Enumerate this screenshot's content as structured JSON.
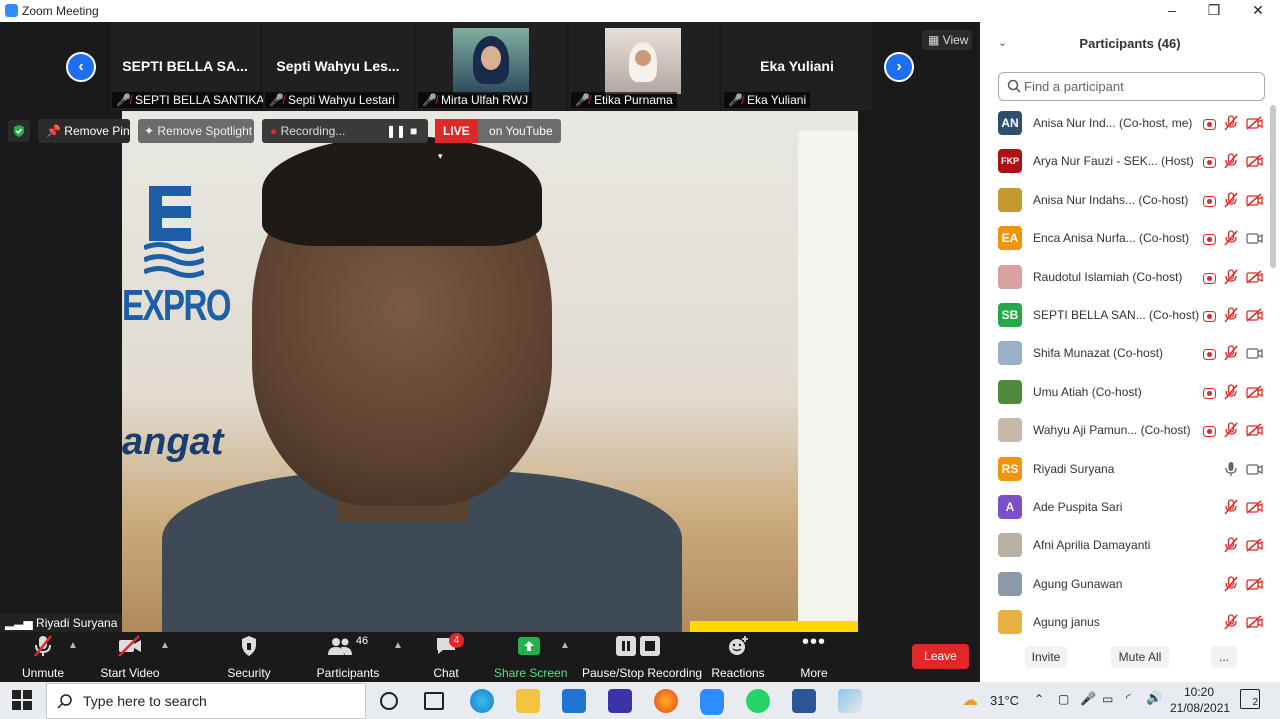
{
  "window": {
    "title": "Zoom Meeting",
    "controls": [
      "–",
      "❐",
      "✕"
    ]
  },
  "strip": {
    "tiles": [
      {
        "name": "SEPTI BELLA SA...",
        "label": "SEPTI BELLA SANTIKA"
      },
      {
        "name": "Septi Wahyu Les...",
        "label": "Septi Wahyu Lestari"
      },
      {
        "name": "",
        "label": "Mirta Ulfah RWJ"
      },
      {
        "name": "",
        "label": "Etika Purnama"
      },
      {
        "name": "Eka Yuliani",
        "label": "Eka Yuliani"
      }
    ],
    "view_label": "View"
  },
  "video": {
    "remove_pin": "Remove Pin",
    "remove_spotlight": "Remove Spotlight",
    "recording": "Recording...",
    "live": "LIVE",
    "live_dest": "on YouTube",
    "speaker": "Riyadi Suryana",
    "bg_text": {
      "expro": "EXPRO",
      "semangat": "angat"
    }
  },
  "toolbar": {
    "unmute": "Unmute",
    "start_video": "Start Video",
    "security": "Security",
    "participants": "Participants",
    "participants_count": "46",
    "chat": "Chat",
    "chat_badge": "4",
    "share_screen": "Share Screen",
    "recording": "Pause/Stop Recording",
    "reactions": "Reactions",
    "more": "More",
    "leave": "Leave"
  },
  "panel": {
    "title": "Participants (46)",
    "search_placeholder": "Find a participant",
    "participants": [
      {
        "initials": "AN",
        "color": "#2f4f6f",
        "name": "Anisa Nur Ind... (Co-host, me)",
        "rec": true,
        "mic": "muted",
        "cam": "off"
      },
      {
        "initials": "FKP",
        "color": "#b01010",
        "name": "Arya Nur Fauzi - SEK... (Host)",
        "rec": true,
        "mic": "muted",
        "cam": "off"
      },
      {
        "initials": "",
        "color": "#c49a2c",
        "name": "Anisa Nur Indahs... (Co-host)",
        "rec": true,
        "mic": "muted",
        "cam": "off"
      },
      {
        "initials": "EA",
        "color": "#f0940a",
        "name": "Enca Anisa Nurfa... (Co-host)",
        "rec": true,
        "mic": "muted",
        "cam": "on"
      },
      {
        "initials": "",
        "color": "#d9a0a0",
        "name": "Raudotul Islamiah (Co-host)",
        "rec": true,
        "mic": "muted",
        "cam": "off"
      },
      {
        "initials": "SB",
        "color": "#25a84a",
        "name": "SEPTI BELLA SAN... (Co-host)",
        "rec": true,
        "mic": "muted",
        "cam": "off"
      },
      {
        "initials": "",
        "color": "#9ab0c8",
        "name": "Shifa Munazat (Co-host)",
        "rec": true,
        "mic": "muted",
        "cam": "on"
      },
      {
        "initials": "",
        "color": "#4f8a3c",
        "name": "Umu Atiah (Co-host)",
        "rec": true,
        "mic": "muted",
        "cam": "off"
      },
      {
        "initials": "",
        "color": "#c8b8a8",
        "name": "Wahyu Aji Pamun... (Co-host)",
        "rec": true,
        "mic": "muted",
        "cam": "off"
      },
      {
        "initials": "RS",
        "color": "#f0940a",
        "name": "Riyadi Suryana",
        "rec": false,
        "mic": "on",
        "cam": "on"
      },
      {
        "initials": "A",
        "color": "#7b4fc9",
        "name": "Ade Puspita Sari",
        "rec": false,
        "mic": "muted",
        "cam": "off"
      },
      {
        "initials": "",
        "color": "#b8b0a0",
        "name": "Afni Aprilia Damayanti",
        "rec": false,
        "mic": "muted",
        "cam": "off"
      },
      {
        "initials": "",
        "color": "#8a9aa8",
        "name": "Agung Gunawan",
        "rec": false,
        "mic": "muted",
        "cam": "off"
      },
      {
        "initials": "",
        "color": "#e8b040",
        "name": "Agung janus",
        "rec": false,
        "mic": "muted",
        "cam": "off"
      }
    ],
    "invite": "Invite",
    "mute_all": "Mute All",
    "more": "..."
  },
  "taskbar": {
    "search_placeholder": "Type here to search",
    "weather": "31°C",
    "time": "10:20",
    "date": "21/08/2021",
    "notifications": "2"
  }
}
